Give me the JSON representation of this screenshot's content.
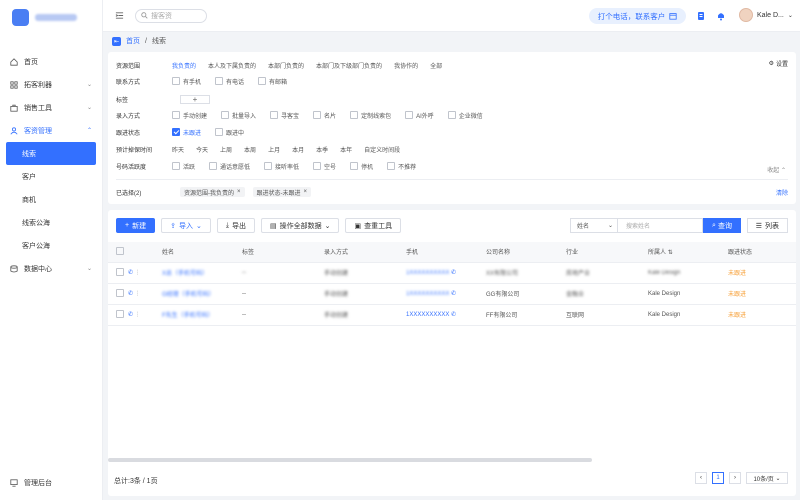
{
  "sidebar": {
    "items": [
      {
        "label": "首页",
        "icon": "home-icon"
      },
      {
        "label": "拓客利器",
        "icon": "grid-icon",
        "expandable": true
      },
      {
        "label": "销售工具",
        "icon": "briefcase-icon",
        "expandable": true
      },
      {
        "label": "客资管理",
        "icon": "users-icon",
        "expandable": true,
        "expanded": true
      }
    ],
    "sub_items": [
      "线索",
      "客户",
      "商机",
      "线索公海",
      "客户公海"
    ],
    "data_center": "数据中心",
    "admin": "管理后台"
  },
  "topbar": {
    "search_placeholder": "搜客资",
    "call_label": "打个电话，联系客户",
    "user_name": "Kale D..."
  },
  "breadcrumb": {
    "home": "首页",
    "sep": "/",
    "current": "线索"
  },
  "filters": {
    "scope_label": "资源范围",
    "scope_options": [
      "我负责的",
      "本人及下属负责的",
      "本部门负责的",
      "本部门及下级部门负责的",
      "我协作的",
      "全部"
    ],
    "contact_label": "联系方式",
    "contact_options": [
      "有手机",
      "有电话",
      "有邮箱"
    ],
    "tag_label": "标签",
    "tag_add": "+",
    "source_label": "录入方式",
    "source_options": [
      "手动创建",
      "批量导入",
      "寻客宝",
      "名片",
      "定制线索包",
      "AI外呼",
      "企业微信"
    ],
    "status_label": "跟进状态",
    "status_options": [
      "未跟进",
      "跟进中"
    ],
    "time_label": "预计掉保时间",
    "time_options": [
      "昨天",
      "今天",
      "上周",
      "本周",
      "上月",
      "本月",
      "本季",
      "本年",
      "自定义时间段"
    ],
    "activity_label": "号码活跃度",
    "activity_options": [
      "活跃",
      "通话意愿低",
      "接听率低",
      "空号",
      "停机",
      "不推荐"
    ],
    "settings": "设置",
    "collapse": "收起",
    "selected_label": "已选择(2)",
    "chips": [
      "资源范围-我负责的",
      "跟进状态-未跟进"
    ],
    "clear": "清除"
  },
  "toolbar": {
    "new": "新建",
    "import": "导入",
    "export": "导出",
    "bulk": "操作全部数据",
    "dedupe": "查重工具",
    "search_field": "姓名",
    "search_placeholder": "搜索姓名",
    "search_btn": "查询",
    "columns": "列表"
  },
  "table": {
    "headers": [
      "姓名",
      "标签",
      "录入方式",
      "手机",
      "公司名称",
      "行业",
      "所属人",
      "跟进状态"
    ],
    "rows": [
      {
        "name": "X总（手机号码）",
        "tag": "--",
        "source": "手动创建",
        "phone": "1XXXXXXXXXX",
        "company": "XX有限公司",
        "industry": "房地产业",
        "owner": "Kale Design",
        "status": "未跟进"
      },
      {
        "name": "G经理（手机号码）",
        "tag": "--",
        "source": "手动创建",
        "phone": "1XXXXXXXXXX",
        "company": "GG有限公司",
        "industry": "金融业",
        "owner": "Kale Design",
        "status": "未跟进"
      },
      {
        "name": "F先生（手机号码）",
        "tag": "--",
        "source": "手动创建",
        "phone": "1XXXXXXXXXX",
        "company": "FF有限公司",
        "industry": "互联网",
        "owner": "Kale Design",
        "status": "未跟进"
      }
    ]
  },
  "footer": {
    "total": "总计:3条 / 1页",
    "page": "1",
    "page_size": "10条/页"
  }
}
